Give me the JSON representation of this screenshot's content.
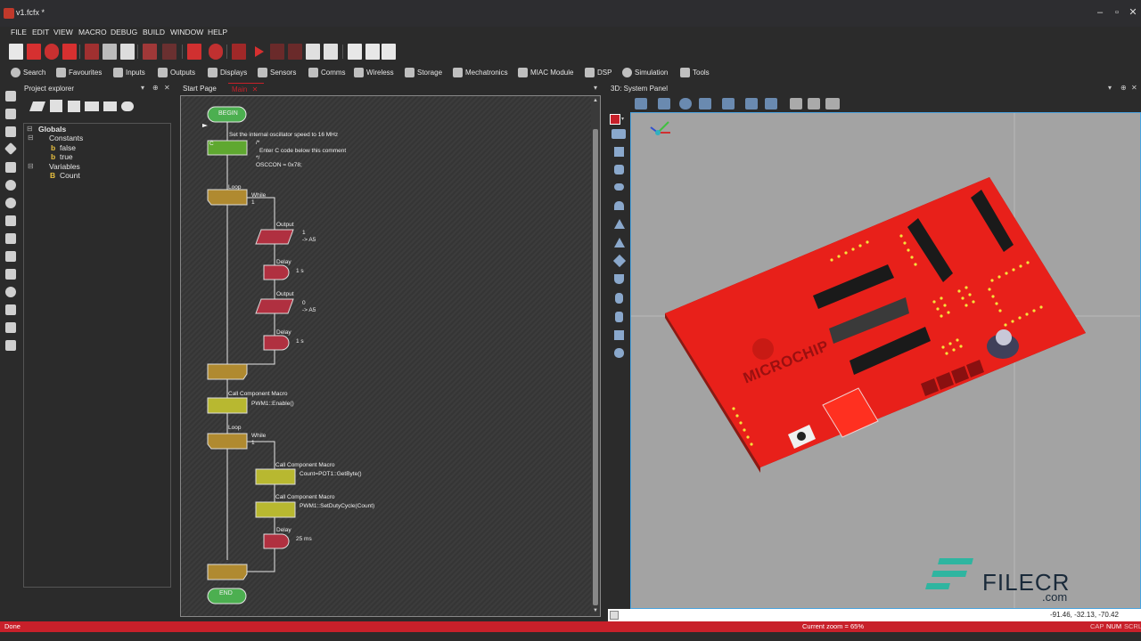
{
  "app": {
    "title": "v1.fcfx *"
  },
  "menu": [
    "FILE",
    "EDIT",
    "VIEW",
    "MACRO",
    "DEBUG",
    "BUILD",
    "WINDOW",
    "HELP"
  ],
  "categories": [
    "Search",
    "Favourites",
    "Inputs",
    "Outputs",
    "Displays",
    "Sensors",
    "Comms",
    "Wireless",
    "Storage",
    "Mechatronics",
    "MIAC Module",
    "DSP",
    "Simulation",
    "Tools"
  ],
  "project_explorer": {
    "title": "Project explorer",
    "globals": "Globals",
    "constants": "Constants",
    "const_items": [
      "false",
      "true"
    ],
    "variables": "Variables",
    "var_items": [
      "Count"
    ]
  },
  "tabs": {
    "start": "Start Page",
    "main": "Main"
  },
  "flowchart": {
    "begin": "BEGIN",
    "end": "END",
    "c_icon": "C",
    "osc_comment": "Set the internal oscillator speed to 16 MHz",
    "code_lines": [
      "/*",
      "Enter C code below this comment",
      "*/",
      "OSCCON = 0x78;"
    ],
    "loop": "Loop",
    "while": "While",
    "while_val": "1",
    "output": "Output",
    "delay": "Delay",
    "out1_val": "1",
    "out1_port": "-> A5",
    "delay1": "1 s",
    "out2_val": "0",
    "out2_port": "-> A5",
    "delay2": "1 s",
    "call_macro": "Call Component Macro",
    "pwm_enable": "PWM1::Enable()",
    "pot_get": "Count=POT1::GetByte()",
    "pwm_duty": "PWM1::SetDutyCycle(Count)",
    "delay3": "25 ms"
  },
  "panel": {
    "title": "3D: System Panel",
    "brand": "MICROCHIP",
    "coords": "-91.46, -32.13, -70.42"
  },
  "watermark": {
    "name": "FILECR",
    "suffix": ".com"
  },
  "status": {
    "left": "Done",
    "zoom": "Current zoom = 65%",
    "cap": "CAP",
    "num": "NUM",
    "scrl": "SCRL"
  },
  "colors": {
    "status_bar": "#c8202a",
    "pcb": "#e8201a",
    "begin_end": "#4caf50",
    "output": "#b03040",
    "delay": "#b03040",
    "loop": "#b08a30",
    "macro": "#b8b830"
  }
}
